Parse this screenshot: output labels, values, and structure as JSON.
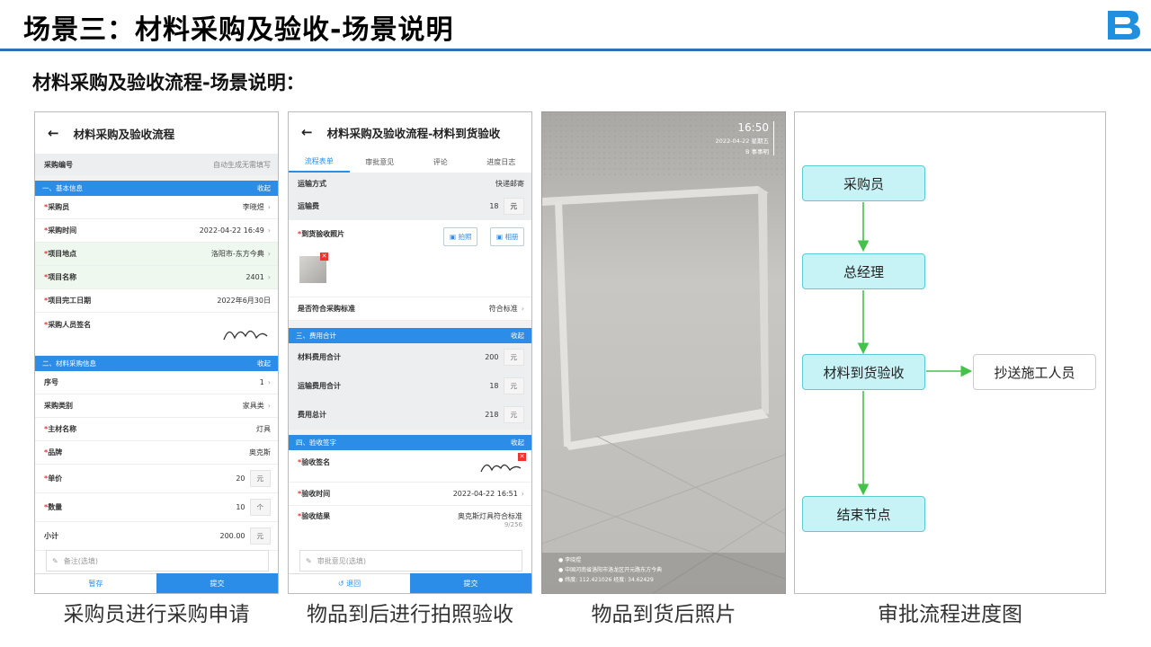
{
  "header": {
    "title": "场景三：材料采购及验收-场景说明"
  },
  "subtitle": "材料采购及验收流程-场景说明：",
  "captions": [
    "采购员进行采购申请",
    "物品到后进行拍照验收",
    "物品到货后照片",
    "审批流程进度图"
  ],
  "phone1": {
    "title": "材料采购及验收流程",
    "code_label": "采购编号",
    "code_value": "自动生成无需填写",
    "sect1": "一、基本信息",
    "collapse": "收起",
    "rows1": [
      {
        "label": "*采购员",
        "value": "李晓煜"
      },
      {
        "label": "*采购时间",
        "value": "2022-04-22 16:49"
      },
      {
        "label": "*项目地点",
        "value": "洛阳市-东方今典"
      },
      {
        "label": "*项目名称",
        "value": "2401"
      },
      {
        "label": "*项目完工日期",
        "value": "2022年6月30日"
      },
      {
        "label": "*采购人员签名",
        "value": ""
      }
    ],
    "sect2": "二、材料采购信息",
    "rows2": [
      {
        "label": "序号",
        "value": "1"
      },
      {
        "label": "采购类别",
        "value": "家具类"
      },
      {
        "label": "*主材名称",
        "value": "灯具"
      },
      {
        "label": "*品牌",
        "value": "奥克斯"
      },
      {
        "label": "*单价",
        "value": "20",
        "unit": "元"
      },
      {
        "label": "*数量",
        "value": "10",
        "unit": "个"
      },
      {
        "label": "小计",
        "value": "200.00",
        "unit": "元"
      }
    ],
    "remark_placeholder": "备注(选填)",
    "btn_save": "暂存",
    "btn_submit": "提交"
  },
  "phone2": {
    "title": "材料采购及验收流程-材料到货验收",
    "tabs": [
      "流程表单",
      "审批意见",
      "评论",
      "进度日志"
    ],
    "ship_label": "运输方式",
    "ship_value": "快递邮寄",
    "fee_label": "运输费",
    "fee_value": "18",
    "unit": "元",
    "photo_label": "*到货验收照片",
    "btn_photo": "拍照",
    "btn_album": "相册",
    "std_label": "是否符合采购标准",
    "std_value": "符合标准",
    "sect3": "三、费用合计",
    "collapse": "收起",
    "costs": [
      {
        "label": "材料费用合计",
        "value": "200"
      },
      {
        "label": "运输费用合计",
        "value": "18"
      },
      {
        "label": "费用总计",
        "value": "218"
      }
    ],
    "sect4": "四、验收签字",
    "sign_label": "*验收签名",
    "time_label": "*验收时间",
    "time_value": "2022-04-22 16:51",
    "result_label": "*验收结果",
    "result_value": "奥克斯灯具符合标准",
    "result_count": "9/256",
    "opinion_placeholder": "审批意见(选填)",
    "btn_back": "退回",
    "btn_submit": "提交"
  },
  "photo": {
    "time": "16:50",
    "date": "2022-04-22 星期五",
    "app": "B 事事明",
    "info": [
      "李晓煜",
      "中国河南省洛阳市洛龙区开元路东方今典",
      "纬度: 112.421026  经度: 34.62429"
    ]
  },
  "flow": {
    "nodes": [
      "采购员",
      "总经理",
      "材料到货验收",
      "抄送施工人员",
      "结束节点"
    ]
  }
}
